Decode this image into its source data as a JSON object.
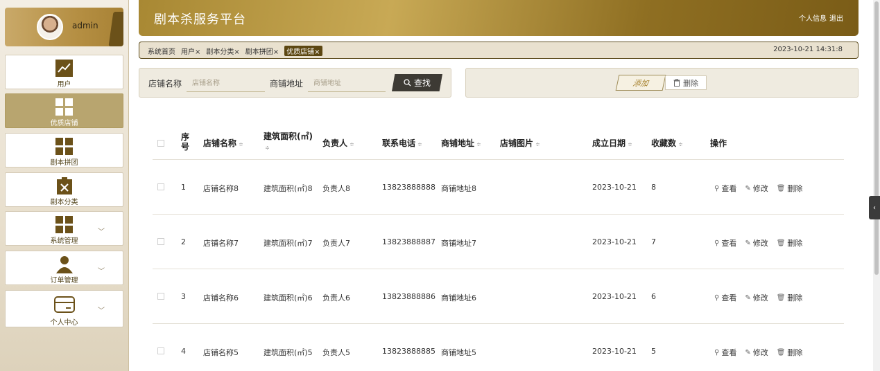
{
  "app": {
    "title": "剧本杀服务平台",
    "profile_link": "个人信息",
    "logout_link": "退出"
  },
  "user": {
    "name": "admin"
  },
  "sidebar": {
    "items": [
      {
        "label": "用户",
        "icon": "chart-line-icon",
        "active": false,
        "expandable": false
      },
      {
        "label": "优质店铺",
        "icon": "grid-icon",
        "active": true,
        "expandable": false
      },
      {
        "label": "剧本拼团",
        "icon": "grid-icon",
        "active": false,
        "expandable": false
      },
      {
        "label": "剧本分类",
        "icon": "clipboard-x-icon",
        "active": false,
        "expandable": false
      },
      {
        "label": "系统管理",
        "icon": "grid-icon",
        "active": false,
        "expandable": true
      },
      {
        "label": "订单管理",
        "icon": "person-icon",
        "active": false,
        "expandable": true
      },
      {
        "label": "个人中心",
        "icon": "card-icon",
        "active": false,
        "expandable": true
      }
    ],
    "expand_glyph": "﹀"
  },
  "breadcrumb": {
    "tags": [
      {
        "label": "系统首页"
      },
      {
        "label": "用户×"
      },
      {
        "label": "剧本分类×"
      },
      {
        "label": "剧本拼团×"
      },
      {
        "label": "优质店铺×"
      }
    ],
    "timestamp": "2023-10-21 14:31:8"
  },
  "search": {
    "shop_name_label": "店铺名称",
    "shop_name_placeholder": "店铺名称",
    "address_label": "商铺地址",
    "address_placeholder": "商铺地址",
    "button_label": "查找"
  },
  "actions": {
    "add_label": "添加",
    "delete_label": "删除"
  },
  "table": {
    "columns": [
      "序号",
      "店铺名称",
      "建筑面积(㎡)",
      "负责人",
      "联系电话",
      "商铺地址",
      "店铺图片",
      "成立日期",
      "收藏数",
      "操作"
    ],
    "rows": [
      {
        "index": "1",
        "shop": "店铺名称8",
        "area": "建筑面积(㎡)8",
        "manager": "负责人8",
        "phone": "13823888888",
        "address": "商铺地址8",
        "date": "2023-10-21",
        "favorites": "8"
      },
      {
        "index": "2",
        "shop": "店铺名称7",
        "area": "建筑面积(㎡)7",
        "manager": "负责人7",
        "phone": "13823888887",
        "address": "商铺地址7",
        "date": "2023-10-21",
        "favorites": "7"
      },
      {
        "index": "3",
        "shop": "店铺名称6",
        "area": "建筑面积(㎡)6",
        "manager": "负责人6",
        "phone": "13823888886",
        "address": "商铺地址6",
        "date": "2023-10-21",
        "favorites": "6"
      },
      {
        "index": "4",
        "shop": "店铺名称5",
        "area": "建筑面积(㎡)5",
        "manager": "负责人5",
        "phone": "13823888885",
        "address": "商铺地址5",
        "date": "2023-10-21",
        "favorites": "5"
      }
    ],
    "ops": {
      "view": "查看",
      "edit": "修改",
      "delete": "删除"
    },
    "sort_glyph": "≑"
  },
  "colors": {
    "brand_dark": "#6b5119",
    "brand_gold": "#b8a56f",
    "header_gold": "#a88833"
  }
}
